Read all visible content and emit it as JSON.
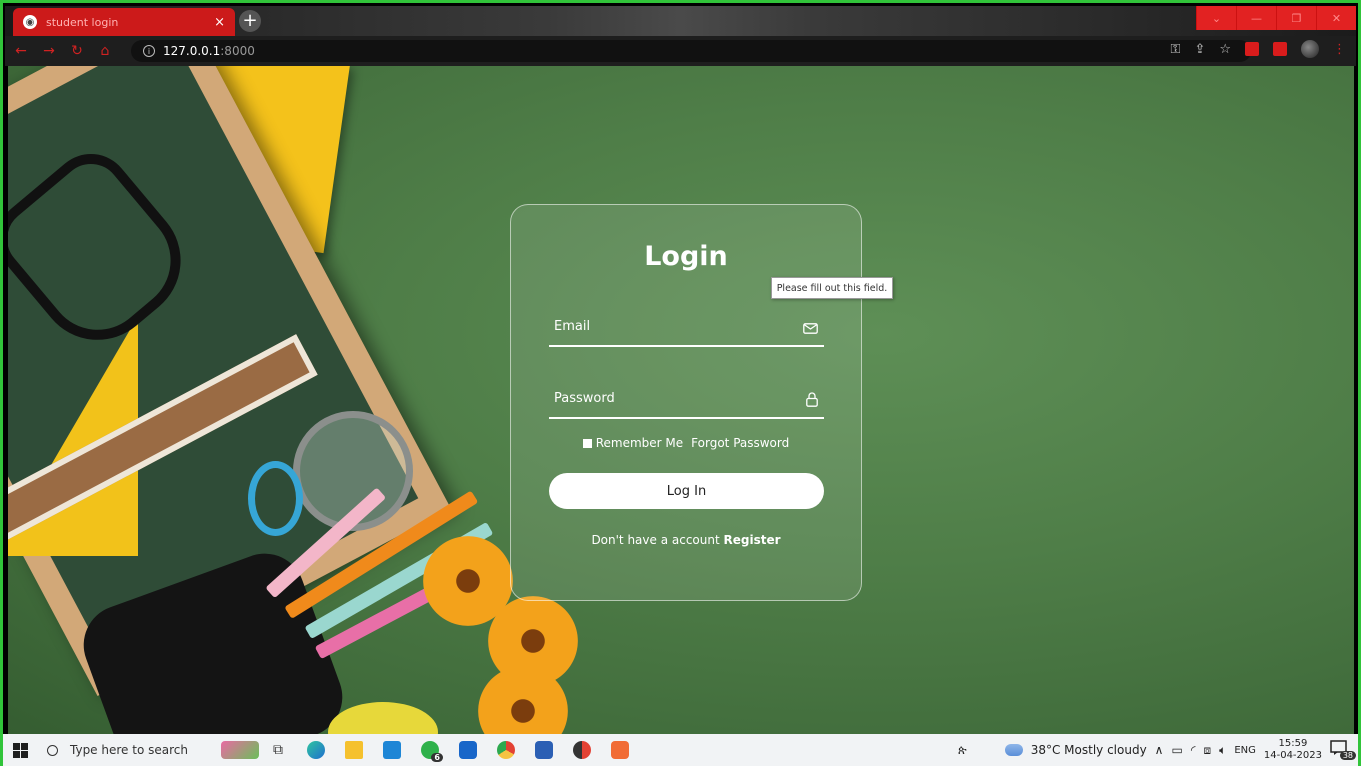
{
  "browser": {
    "tab_title": "student login",
    "tab_close": "×",
    "new_tab": "+",
    "url_host": "127.0.0.1",
    "url_port": ":8000",
    "window_controls": [
      "⌄",
      "—",
      "❐",
      "✕"
    ]
  },
  "login": {
    "title": "Login",
    "email_label": "Email",
    "password_label": "Password",
    "remember_label": "Remember Me",
    "forgot_label": "Forgot Password",
    "login_button": "Log In",
    "no_account_text": "Don't have a account",
    "register_link": "Register",
    "tooltip": "Please fill out this field."
  },
  "taskbar": {
    "search_placeholder": "Type here to search",
    "weather": "38°C  Mostly cloudy",
    "language": "ENG",
    "time": "15:59",
    "date": "14-04-2023",
    "notification_count": "38",
    "whatsapp_badge": "6"
  },
  "colors": {
    "frame_green": "#31c43a",
    "tab_red": "#cc1a1a",
    "background_green": "#4f7e48",
    "card_border": "#ffffff"
  },
  "icons": [
    "globe-icon",
    "close-icon",
    "plus-icon",
    "back-arrow-icon",
    "forward-arrow-icon",
    "reload-icon",
    "home-icon",
    "info-icon",
    "key-icon",
    "share-icon",
    "star-icon",
    "mail-icon",
    "lock-icon",
    "windows-icon",
    "search-icon"
  ]
}
